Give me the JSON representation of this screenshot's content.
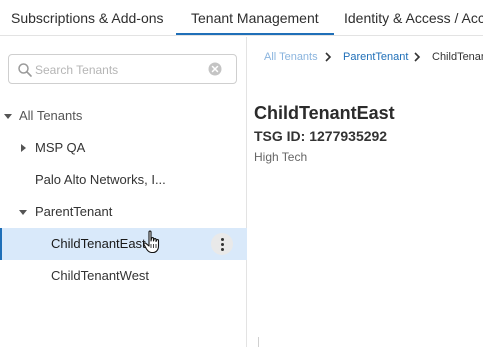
{
  "tabs": [
    {
      "label": "Subscriptions & Add-ons",
      "active": false
    },
    {
      "label": "Tenant Management",
      "active": true
    },
    {
      "label": "Identity & Access / Acc",
      "active": false
    }
  ],
  "sidebar": {
    "search": {
      "placeholder": "Search Tenants",
      "value": ""
    },
    "tree": {
      "all": {
        "label": "All Tenants",
        "expanded": true
      },
      "msp_qa": {
        "label": "MSP QA",
        "expanded": false
      },
      "palo_alto": {
        "label": "Palo Alto Networks, I..."
      },
      "parent": {
        "label": "ParentTenant",
        "expanded": true
      },
      "child_east": {
        "label": "ChildTenantEast",
        "selected": true
      },
      "child_west": {
        "label": "ChildTenantWest"
      }
    }
  },
  "main": {
    "breadcrumb": [
      "All Tenants",
      "ParentTenant",
      "ChildTenan"
    ],
    "tenant_name": "ChildTenantEast",
    "tsg_id": "TSG ID: 1277935292",
    "industry": "High Tech"
  },
  "colors": {
    "accent": "#1f6fb8",
    "selected_row": "#d9e9fa",
    "breadcrumb_muted": "#8ab4de"
  },
  "icons": [
    "search-icon",
    "clear-icon",
    "caret-down-icon",
    "caret-right-icon",
    "more-vertical-icon",
    "chevron-right-icon",
    "hand-cursor-icon"
  ]
}
